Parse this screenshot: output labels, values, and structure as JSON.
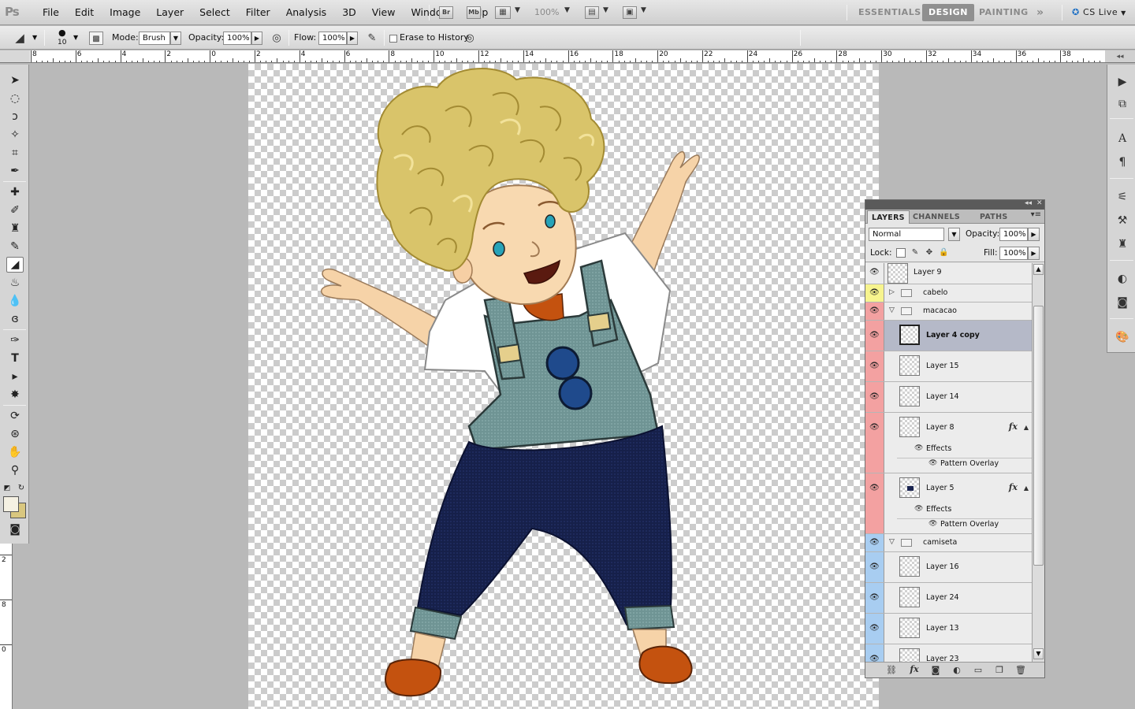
{
  "app": {
    "logo": "Ps",
    "menu": [
      "File",
      "Edit",
      "Image",
      "Layer",
      "Select",
      "Filter",
      "Analysis",
      "3D",
      "View",
      "Window",
      "Help"
    ],
    "bridge_label": "Br",
    "minibridge_label": "Mb",
    "zoom_level": "100%",
    "workspaces": [
      "ESSENTIALS",
      "DESIGN",
      "PAINTING"
    ],
    "active_workspace": "DESIGN",
    "more_workspaces": "»",
    "cs_live": "CS Live"
  },
  "options": {
    "brush_size": "10",
    "mode_label": "Mode:",
    "mode_value": "Brush",
    "opacity_label": "Opacity:",
    "opacity_value": "100%",
    "flow_label": "Flow:",
    "flow_value": "100%",
    "erase_history_label": "Erase to History"
  },
  "ruler": {
    "h_labels": [
      "8",
      "6",
      "4",
      "2",
      "0",
      "2",
      "4",
      "6",
      "8",
      "10",
      "12",
      "14",
      "16",
      "18",
      "20",
      "22",
      "24",
      "26",
      "28",
      "30",
      "32",
      "34",
      "36",
      "38"
    ],
    "v_labels": [
      "2",
      "8",
      "0"
    ]
  },
  "layers_panel": {
    "tabs": [
      "LAYERS",
      "CHANNELS",
      "PATHS"
    ],
    "active_tab": "LAYERS",
    "blend_mode": "Normal",
    "opacity_label": "Opacity:",
    "opacity_value": "100%",
    "lock_label": "Lock:",
    "fill_label": "Fill:",
    "fill_value": "100%",
    "layers": [
      {
        "name": "Layer 9",
        "type": "layer",
        "color": ""
      },
      {
        "name": "cabelo",
        "type": "group-collapsed",
        "color": "yellow"
      },
      {
        "name": "macacao",
        "type": "group-open",
        "color": "red"
      },
      {
        "name": "Layer 4 copy",
        "type": "layer",
        "color": "red",
        "selected": true
      },
      {
        "name": "Layer 15",
        "type": "layer",
        "color": "red"
      },
      {
        "name": "Layer 14",
        "type": "layer",
        "color": "red"
      },
      {
        "name": "Layer 8",
        "type": "layer-fx",
        "color": "red",
        "effects_label": "Effects",
        "effect": "Pattern Overlay"
      },
      {
        "name": "Layer 5",
        "type": "layer-fx",
        "color": "red",
        "effects_label": "Effects",
        "effect": "Pattern Overlay"
      },
      {
        "name": "camiseta",
        "type": "group-open",
        "color": "blue"
      },
      {
        "name": "Layer 16",
        "type": "layer",
        "color": "blue"
      },
      {
        "name": "Layer 24",
        "type": "layer",
        "color": "blue"
      },
      {
        "name": "Layer 13",
        "type": "layer",
        "color": "blue"
      },
      {
        "name": "Layer 23",
        "type": "layer",
        "color": "blue"
      }
    ],
    "fx_glyph": "fx",
    "label_colors": {
      "yellow": "#f7f48e",
      "red": "#f3a1a1",
      "blue": "#a8cdf1"
    }
  },
  "colors": {
    "foreground": "#f5f1e3",
    "background": "#d9c77f",
    "selection": "#b5b9c8"
  }
}
